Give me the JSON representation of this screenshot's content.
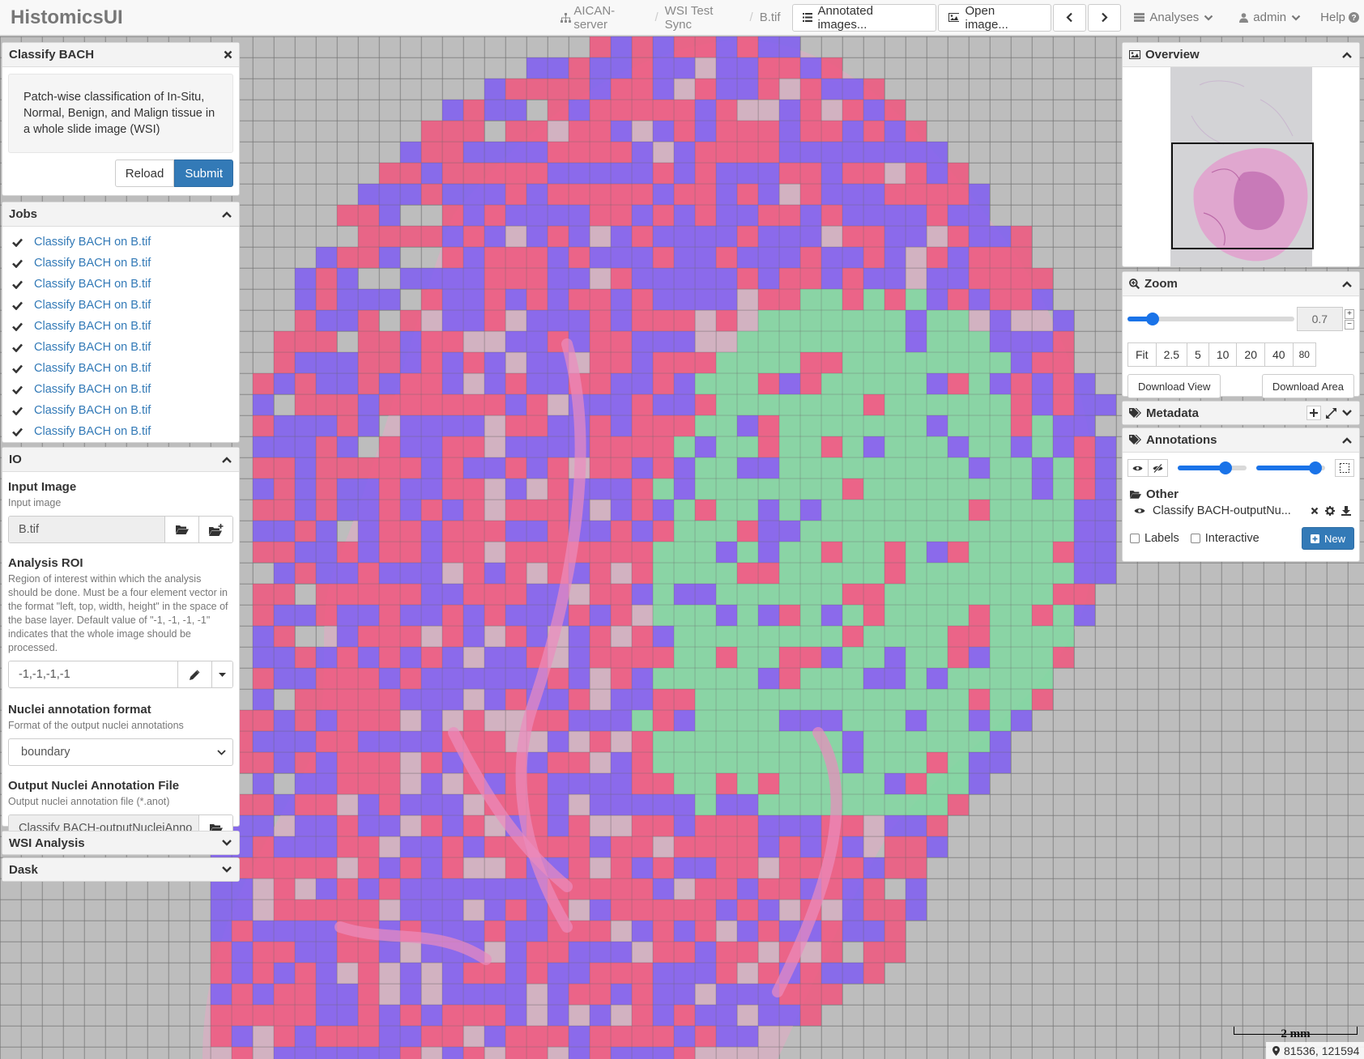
{
  "app": {
    "brand": "HistomicsUI"
  },
  "breadcrumb": {
    "server": "AICAN-server",
    "folder": "WSI Test Sync",
    "file": "B.tif"
  },
  "nav": {
    "annotated_images": "Annotated images...",
    "open_image": "Open image...",
    "analyses": "Analyses",
    "user": "admin",
    "help": "Help"
  },
  "analysis_panel": {
    "title": "Classify BACH",
    "description": "Patch-wise classification of In-Situ, Normal, Benign, and Malign tissue in a whole slide image (WSI)",
    "reload": "Reload",
    "submit": "Submit"
  },
  "jobs": {
    "title": "Jobs",
    "items": [
      "Classify BACH on B.tif",
      "Classify BACH on B.tif",
      "Classify BACH on B.tif",
      "Classify BACH on B.tif",
      "Classify BACH on B.tif",
      "Classify BACH on B.tif",
      "Classify BACH on B.tif",
      "Classify BACH on B.tif",
      "Classify BACH on B.tif",
      "Classify BACH on B.tif"
    ]
  },
  "io": {
    "title": "IO",
    "input_image": {
      "label": "Input Image",
      "help": "Input image",
      "value": "B.tif"
    },
    "roi": {
      "label": "Analysis ROI",
      "help": "Region of interest within which the analysis should be done. Must be a four element vector in the format \"left, top, width, height\" in the space of the base layer. Default value of \"-1, -1, -1, -1\" indicates that the whole image should be processed.",
      "value": "-1,-1,-1,-1"
    },
    "nuclei_format": {
      "label": "Nuclei annotation format",
      "help": "Format of the output nuclei annotations",
      "value": "boundary"
    },
    "output_file": {
      "label": "Output Nuclei Annotation File",
      "help": "Output nuclei annotation file (*.anot)",
      "value": "Classify BACH-outputNucleiAnno"
    }
  },
  "wsi_analysis": {
    "title": "WSI Analysis"
  },
  "dask": {
    "title": "Dask"
  },
  "overview": {
    "title": "Overview"
  },
  "zoom": {
    "title": "Zoom",
    "value": "0.7",
    "slider_level": 0.15,
    "plus": "+",
    "minus": "−",
    "mags": [
      "Fit",
      "2.5",
      "5",
      "10",
      "20",
      "40",
      "80"
    ],
    "download_view": "Download View",
    "download_area": "Download Area"
  },
  "metadata": {
    "title": "Metadata"
  },
  "annotations": {
    "title": "Annotations",
    "opacity_level": 0.68,
    "fill_opacity_level": 0.85,
    "group": "Other",
    "item": "Classify BACH-outputNu...",
    "labels": "Labels",
    "interactive": "Interactive",
    "new": "New"
  },
  "scale": {
    "label": "2 mm"
  },
  "coords": {
    "value": "81536, 121594"
  },
  "colors": {
    "primary": "#337ab7",
    "normal": "#f0567e",
    "benign": "#7f5df2",
    "invasive": "#7ed9a0"
  }
}
